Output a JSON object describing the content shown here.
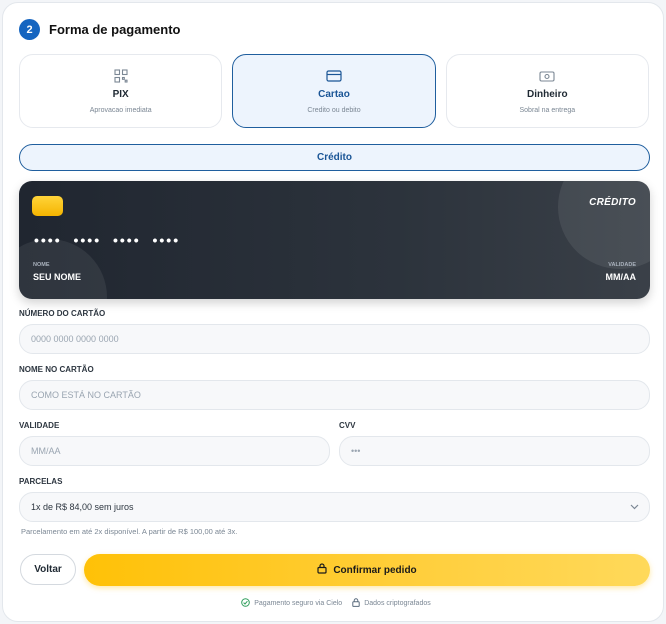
{
  "header": {
    "step": "2",
    "title": "Forma de pagamento"
  },
  "methods": [
    {
      "label": "PIX",
      "sub": "Aprovacao imediata",
      "icon": "qr-code-icon",
      "active": false
    },
    {
      "label": "Cartao",
      "sub": "Credito ou debito",
      "icon": "credit-card-icon",
      "active": true
    },
    {
      "label": "Dinheiro",
      "sub": "Sobral na entrega",
      "icon": "cash-icon",
      "active": false
    }
  ],
  "card_type_toggle": "Crédito",
  "card_preview": {
    "brand": "CRÉDITO",
    "number": "•••• •••• •••• ••••",
    "name_label": "NOME",
    "name_value": "SEU NOME",
    "validity_label": "VALIDADE",
    "validity_value": "MM/AA"
  },
  "form": {
    "card_number": {
      "label": "NÚMERO DO CARTÃO",
      "placeholder": "0000 0000 0000 0000"
    },
    "card_name": {
      "label": "NOME NO CARTÃO",
      "placeholder": "COMO ESTÁ NO CARTÃO"
    },
    "validity": {
      "label": "VALIDADE",
      "placeholder": "MM/AA"
    },
    "cvv": {
      "label": "CVV",
      "placeholder": "•••"
    },
    "installments": {
      "label": "PARCELAS",
      "value": "1x de R$ 84,00 sem juros"
    },
    "hint": "Parcelamento em até 2x disponível. A partir de R$ 100,00 até 3x."
  },
  "actions": {
    "back": "Voltar",
    "confirm": "Confirmar pedido"
  },
  "footer": {
    "secure": "Pagamento seguro via Cielo",
    "encrypted": "Dados criptografados"
  },
  "colors": {
    "primary": "#1565c0",
    "accent": "#ffc107",
    "card": "#2c333c"
  }
}
